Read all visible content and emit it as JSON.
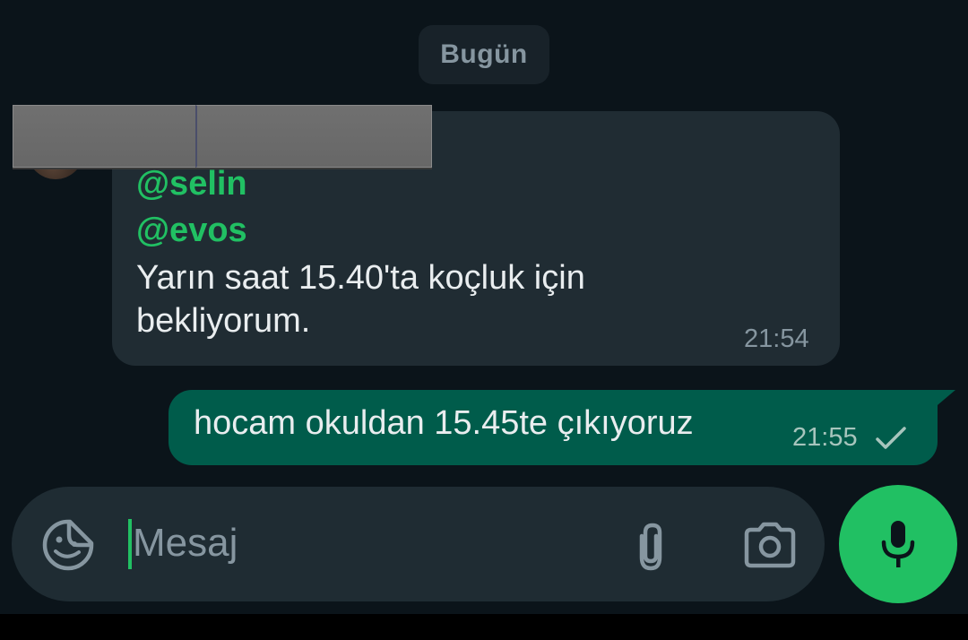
{
  "date_chip": {
    "label": "Bugün"
  },
  "incoming_message": {
    "mentions": [
      "@selin",
      "@evos"
    ],
    "text": "Yarın saat 15.40'ta koçluk için bekliyorum.",
    "time": "21:54"
  },
  "outgoing_message": {
    "text": "hocam okuldan 15.45te çıkıyoruz",
    "time": "21:55",
    "status_icon": "single-check-icon"
  },
  "composer": {
    "placeholder": "Mesaj",
    "value": "",
    "icons": [
      "sticker-icon",
      "attach-icon",
      "camera-icon",
      "mic-icon"
    ]
  },
  "colors": {
    "background": "#0b141a",
    "incoming_bubble": "#202c33",
    "outgoing_bubble": "#005c4b",
    "mention": "#21c063",
    "accent": "#21c063"
  }
}
